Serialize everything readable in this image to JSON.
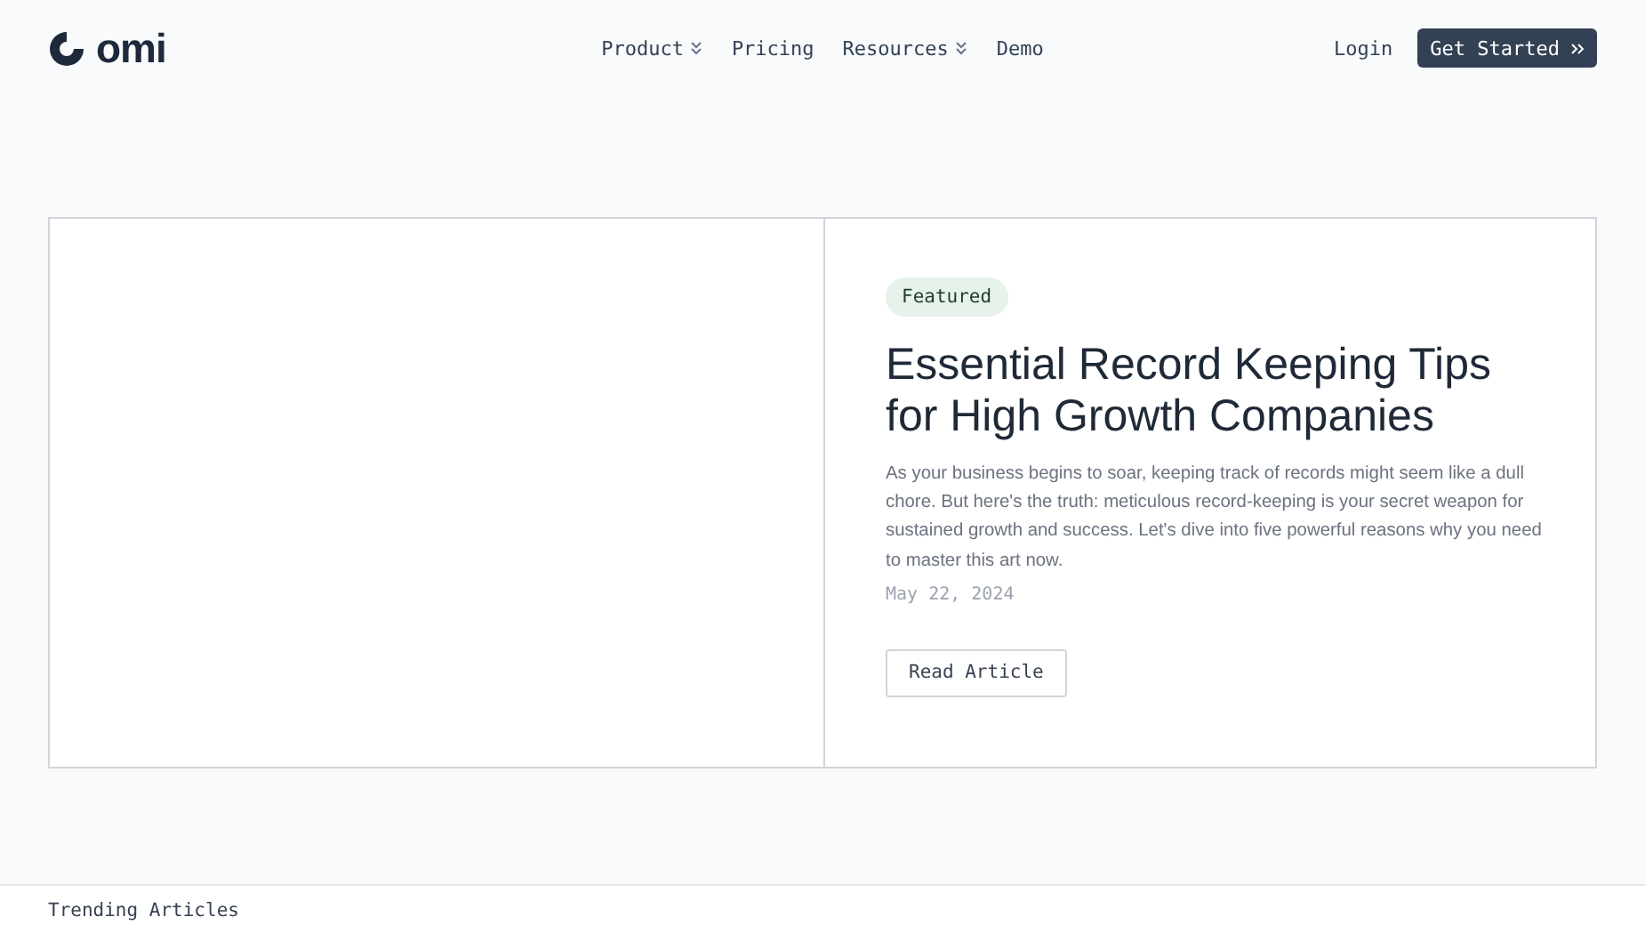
{
  "logo": {
    "text": "omi"
  },
  "nav": [
    {
      "label": "Product",
      "dropdown": true
    },
    {
      "label": "Pricing",
      "dropdown": false
    },
    {
      "label": "Resources",
      "dropdown": true
    },
    {
      "label": "Demo",
      "dropdown": false
    }
  ],
  "login": "Login",
  "cta": {
    "label": "Get Started"
  },
  "featured": {
    "badge": "Featured",
    "title": "Essential Record Keeping Tips for High Growth Companies",
    "summary": "As your business begins to soar, keeping track of records might seem like a dull chore. But here's the truth: meticulous record-keeping is your secret weapon for sustained growth and success. Let's dive into five powerful reasons why you need to master this art now.",
    "date": "May 22, 2024",
    "button": "Read Article"
  },
  "trending": {
    "heading": "Trending Articles"
  }
}
